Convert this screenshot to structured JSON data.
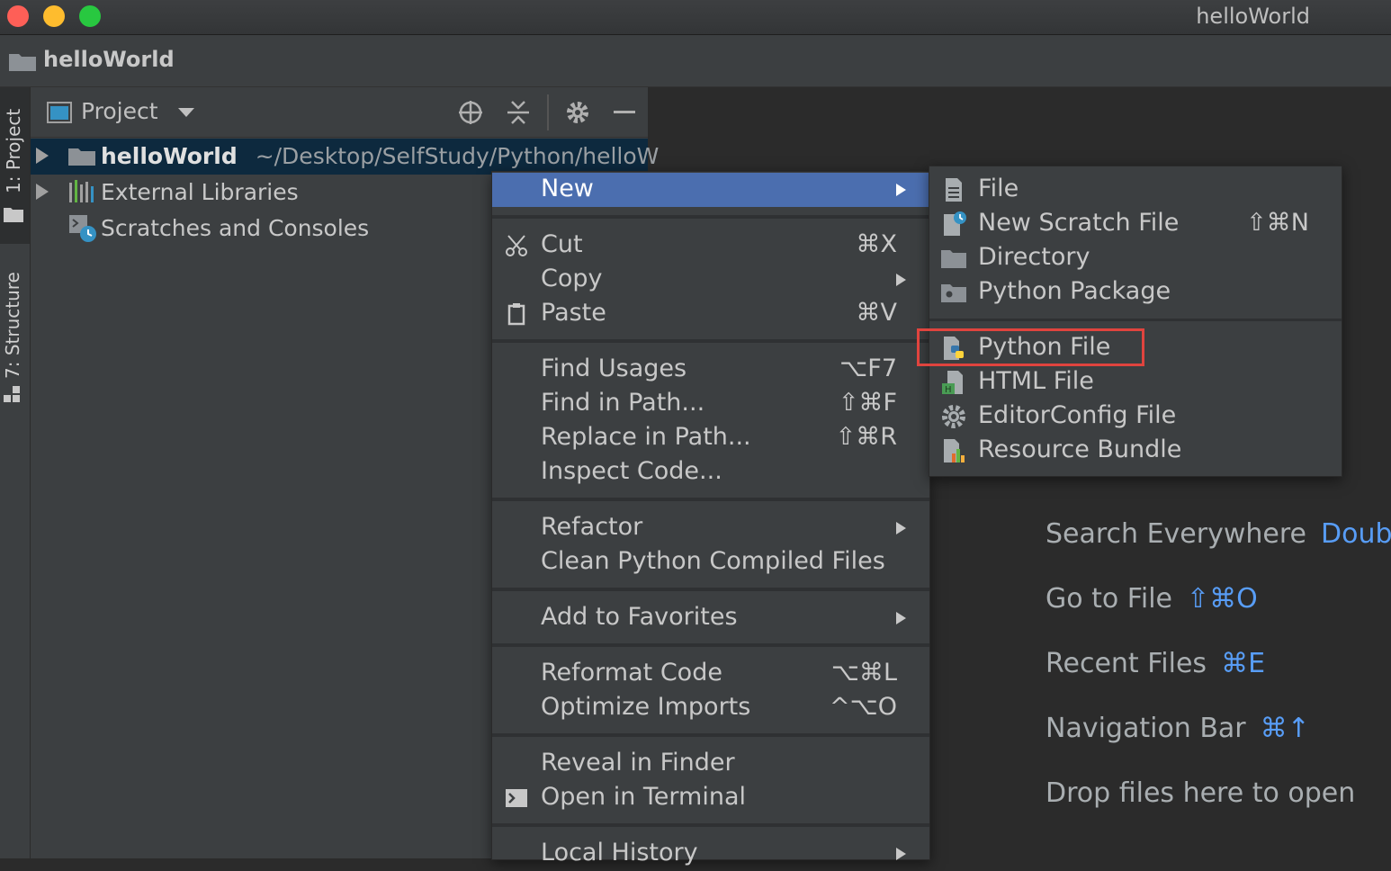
{
  "window": {
    "title": "helloWorld"
  },
  "navbar": {
    "project_name": "helloWorld"
  },
  "left_strip": {
    "project_tab": "1: Project",
    "structure_tab": "7: Structure"
  },
  "project_panel": {
    "view_label": "Project",
    "tree": [
      {
        "label": "helloWorld",
        "path": "~/Desktop/SelfStudy/Python/helloW",
        "selected": true
      },
      {
        "label": "External Libraries"
      },
      {
        "label": "Scratches and Consoles"
      }
    ]
  },
  "context_menu": {
    "new": "New",
    "cut": {
      "label": "Cut",
      "shortcut": "⌘X"
    },
    "copy": {
      "label": "Copy"
    },
    "paste": {
      "label": "Paste",
      "shortcut": "⌘V"
    },
    "find_usages": {
      "label": "Find Usages",
      "shortcut": "⌥F7"
    },
    "find_in_path": {
      "label": "Find in Path...",
      "shortcut": "⇧⌘F"
    },
    "replace_in_path": {
      "label": "Replace in Path...",
      "shortcut": "⇧⌘R"
    },
    "inspect_code": {
      "label": "Inspect Code..."
    },
    "refactor": {
      "label": "Refactor"
    },
    "clean_python": {
      "label": "Clean Python Compiled Files"
    },
    "add_favorites": {
      "label": "Add to Favorites"
    },
    "reformat_code": {
      "label": "Reformat Code",
      "shortcut": "⌥⌘L"
    },
    "optimize_imports": {
      "label": "Optimize Imports",
      "shortcut": "^⌥O"
    },
    "reveal_finder": {
      "label": "Reveal in Finder"
    },
    "open_terminal": {
      "label": "Open in Terminal"
    },
    "local_history": {
      "label": "Local History"
    }
  },
  "new_submenu": {
    "file": "File",
    "scratch": {
      "label": "New Scratch File",
      "shortcut": "⇧⌘N"
    },
    "directory": "Directory",
    "python_package": "Python Package",
    "python_file": "Python File",
    "html_file": "HTML File",
    "editorconfig": "EditorConfig File",
    "resource_bundle": "Resource Bundle"
  },
  "editor_hints": [
    {
      "label": "Search Everywhere",
      "key": "Double ⇧"
    },
    {
      "label": "Go to File",
      "key": "⇧⌘O"
    },
    {
      "label": "Recent Files",
      "key": "⌘E"
    },
    {
      "label": "Navigation Bar",
      "key": "⌘↑"
    },
    {
      "label": "Drop files here to open",
      "key": ""
    }
  ],
  "colors": {
    "highlight": "#4b6eaf",
    "annotation": "#e0443e",
    "shortcut_blue": "#589df6"
  }
}
